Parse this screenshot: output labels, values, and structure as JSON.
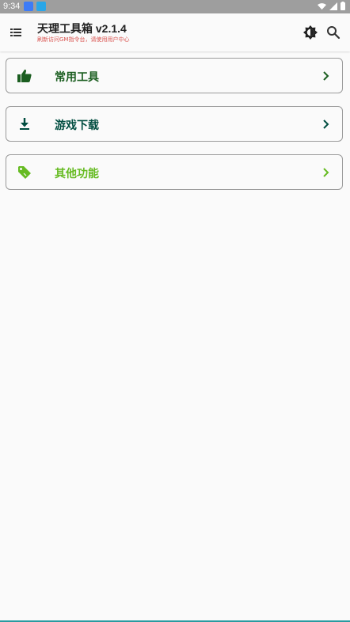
{
  "status_bar": {
    "time": "9:34",
    "notification_icons": [
      "app-notification-icon",
      "download-icon"
    ],
    "system_icons": [
      "wifi-icon",
      "signal-icon",
      "battery-icon"
    ]
  },
  "app_bar": {
    "title": "天理工具箱 v2.1.4",
    "subtitle": "刷新访问GM指令台，请使用用户中心",
    "menu_icon": "list-icon",
    "actions": [
      "theme-toggle-icon",
      "search-icon"
    ]
  },
  "menu": {
    "items": [
      {
        "label": "常用工具",
        "icon": "thumbs-up-icon",
        "color": "#1b5e20"
      },
      {
        "label": "游戏下载",
        "icon": "download-icon",
        "color": "#004d40"
      },
      {
        "label": "其他功能",
        "icon": "tag-icon",
        "color": "#66bb22"
      }
    ]
  },
  "colors": {
    "background": "#fafafa",
    "subtitle": "#d9534f",
    "card_border": "#9a9a9a",
    "accent_bottom": "#2a9aa0"
  }
}
